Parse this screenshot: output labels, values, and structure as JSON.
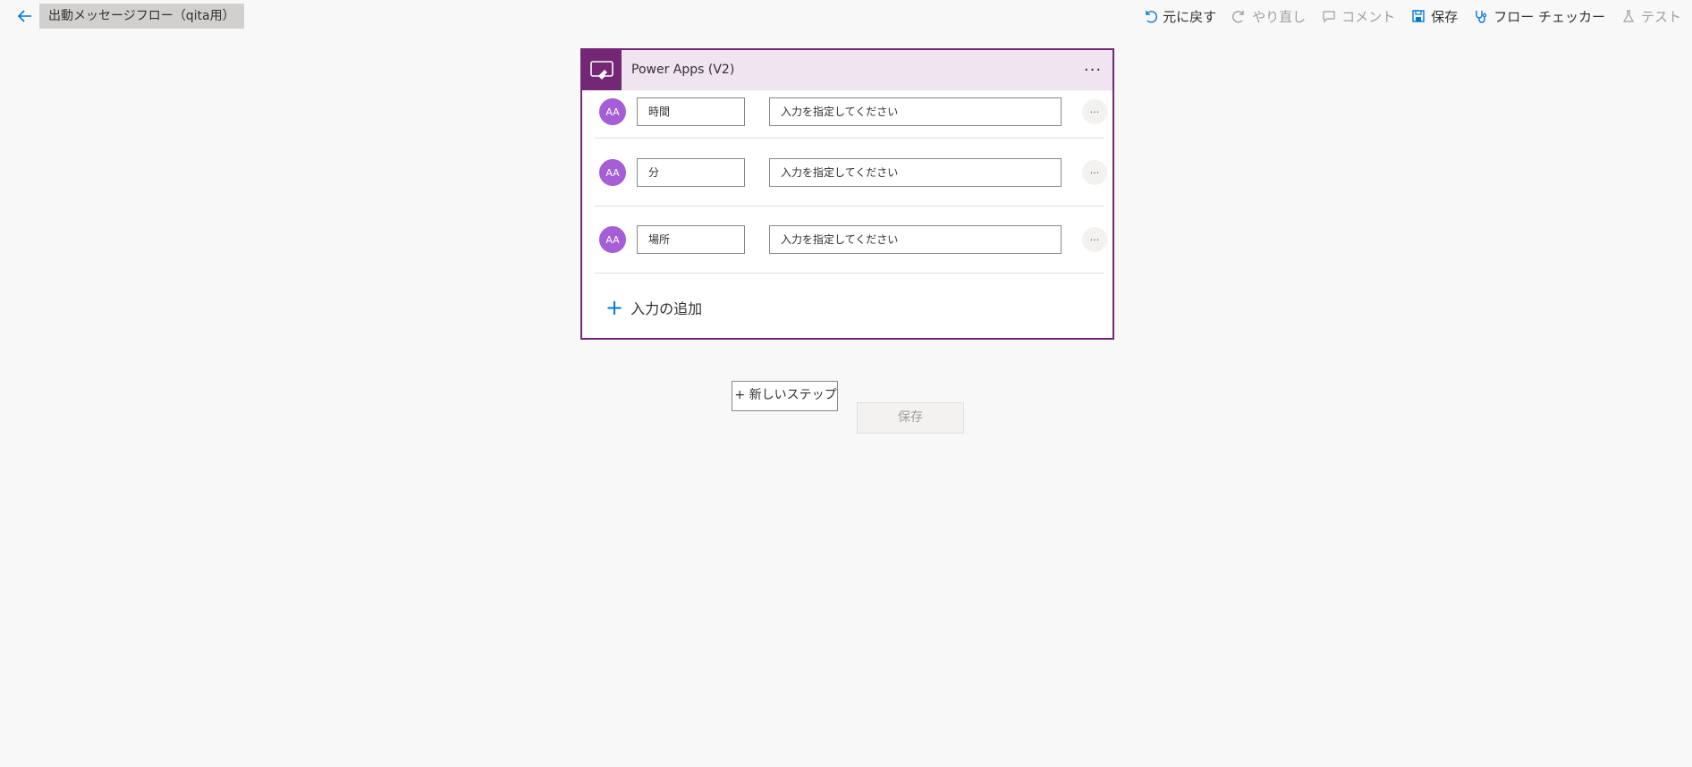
{
  "header": {
    "flow_name": "出動メッセージフロー（qita用）"
  },
  "toolbar": {
    "undo": "元に戻す",
    "redo": "やり直し",
    "comment": "コメント",
    "save": "保存",
    "flow_checker": "フロー チェッカー",
    "test": "テスト"
  },
  "trigger_card": {
    "title": "Power Apps (V2)",
    "more": "···",
    "inputs": [
      {
        "name": "時間",
        "description_placeholder": "入力を指定してください",
        "type_icon": "AA"
      },
      {
        "name": "分",
        "description_placeholder": "入力を指定してください",
        "type_icon": "AA"
      },
      {
        "name": "場所",
        "description_placeholder": "入力を指定してください",
        "type_icon": "AA"
      }
    ],
    "add_input": "入力の追加",
    "row_more": "···"
  },
  "actions": {
    "new_step": "+ 新しいステップ",
    "save": "保存"
  },
  "colors": {
    "accent": "#742774",
    "header_bg": "#f0e4f0",
    "type_icon_bg": "#a55ed6",
    "link_blue": "#0078d4"
  }
}
